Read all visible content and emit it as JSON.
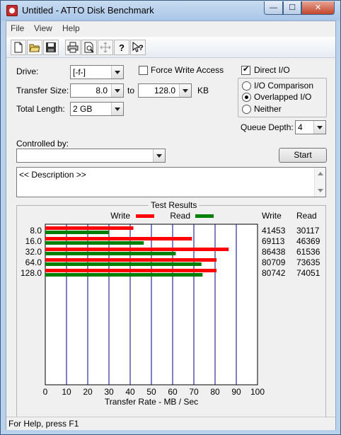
{
  "window": {
    "title": "Untitled - ATTO Disk Benchmark",
    "min_glyph": "—",
    "max_glyph": "☐",
    "close_glyph": "✕"
  },
  "menu": [
    "File",
    "View",
    "Help"
  ],
  "toolbar_icons": [
    "new-icon",
    "open-icon",
    "save-icon",
    "print-icon",
    "print-preview-icon",
    "move-icon",
    "help-icon",
    "context-help-icon"
  ],
  "form": {
    "drive_label": "Drive:",
    "drive_value": "[-f-]",
    "force_write_label": "Force Write Access",
    "force_write_checked": false,
    "direct_io_label": "Direct I/O",
    "direct_io_checked": true,
    "transfer_size_label": "Transfer Size:",
    "transfer_from": "8.0",
    "to_label": "to",
    "transfer_to": "128.0",
    "kb_label": "KB",
    "total_length_label": "Total Length:",
    "total_length_value": "2 GB",
    "io_comparison_label": "I/O Comparison",
    "overlapped_io_label": "Overlapped I/O",
    "neither_label": "Neither",
    "selected_mode": "overlapped",
    "queue_depth_label": "Queue Depth:",
    "queue_depth_value": "4",
    "controlled_by_label": "Controlled by:",
    "controlled_by_value": "",
    "start_label": "Start",
    "description_text": "<< Description >>"
  },
  "results": {
    "title": "Test Results",
    "legend_write": "Write",
    "legend_read": "Read",
    "col_write": "Write",
    "col_read": "Read",
    "write_color": "#ff0000",
    "read_color": "#008000",
    "rows": [
      {
        "size": "8.0",
        "write": "41453",
        "read": "30117"
      },
      {
        "size": "16.0",
        "write": "69113",
        "read": "46369"
      },
      {
        "size": "32.0",
        "write": "86438",
        "read": "61536"
      },
      {
        "size": "64.0",
        "write": "80709",
        "read": "73635"
      },
      {
        "size": "128.0",
        "write": "80742",
        "read": "74051"
      }
    ]
  },
  "chart_data": {
    "type": "bar",
    "orientation": "horizontal",
    "categories": [
      "8.0",
      "16.0",
      "32.0",
      "64.0",
      "128.0"
    ],
    "series": [
      {
        "name": "Write",
        "values": [
          41.5,
          69.1,
          86.4,
          80.7,
          80.7
        ],
        "color": "#ff0000"
      },
      {
        "name": "Read",
        "values": [
          30.1,
          46.4,
          61.5,
          73.6,
          74.1
        ],
        "color": "#008000"
      }
    ],
    "xlabel": "Transfer Rate - MB / Sec",
    "xlim": [
      0,
      100
    ],
    "xticks": [
      "0",
      "10",
      "20",
      "30",
      "40",
      "50",
      "60",
      "70",
      "80",
      "90",
      "100"
    ],
    "grid": true,
    "legend": "top"
  },
  "status": "For Help, press F1"
}
